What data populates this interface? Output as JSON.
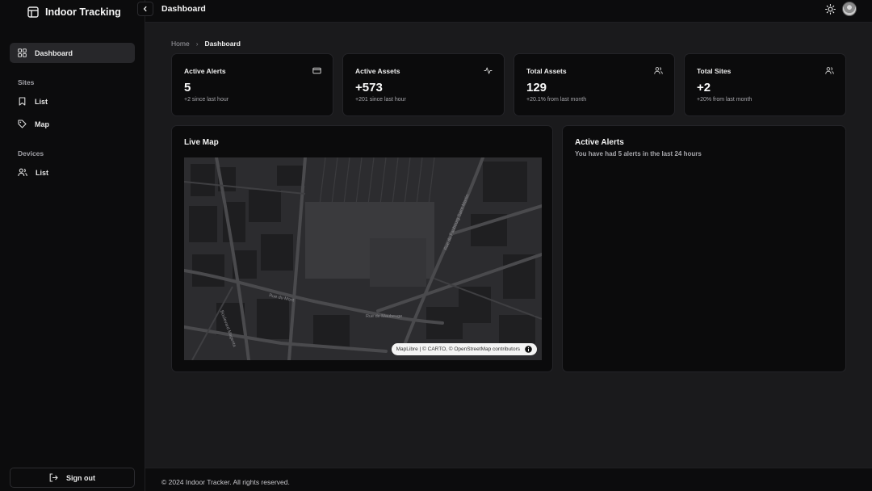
{
  "app": {
    "title": "Indoor Tracking"
  },
  "sidebar": {
    "items": [
      {
        "label": "Dashboard",
        "icon": "grid-icon"
      },
      {
        "label": "List",
        "icon": "bookmark-icon"
      },
      {
        "label": "Map",
        "icon": "tag-icon"
      },
      {
        "label": "List",
        "icon": "users-icon"
      }
    ],
    "sections": [
      "Sites",
      "Devices"
    ],
    "signout_label": "Sign out"
  },
  "header": {
    "title": "Dashboard"
  },
  "breadcrumb": {
    "home": "Home",
    "current": "Dashboard"
  },
  "stats": [
    {
      "title": "Active Alerts",
      "value": "5",
      "sub": "+2 since last hour",
      "icon": "credit-card-icon"
    },
    {
      "title": "Active Assets",
      "value": "+573",
      "sub": "+201 since last hour",
      "icon": "activity-icon"
    },
    {
      "title": "Total Assets",
      "value": "129",
      "sub": "+20.1% from last month",
      "icon": "users-icon"
    },
    {
      "title": "Total Sites",
      "value": "+2",
      "sub": "+20% from last month",
      "icon": "users-icon"
    }
  ],
  "live_map": {
    "title": "Live Map",
    "attribution": "MapLibre | © CARTO, © OpenStreetMap contributors",
    "street_labels": [
      "Rue du Mont",
      "Rue du Faubourg Saint-Martin",
      "Boulevard Magenta",
      "Rue de Maubeuge"
    ]
  },
  "alerts_panel": {
    "title": "Active Alerts",
    "description": "You have had 5 alerts in the last 24 hours"
  },
  "footer": {
    "text": "© 2024 Indoor Tracker. All rights reserved."
  },
  "colors": {
    "background": "#1a1a1c",
    "card": "#0b0b0c",
    "sidebar": "#0c0c0d",
    "active_nav": "#27272a"
  }
}
